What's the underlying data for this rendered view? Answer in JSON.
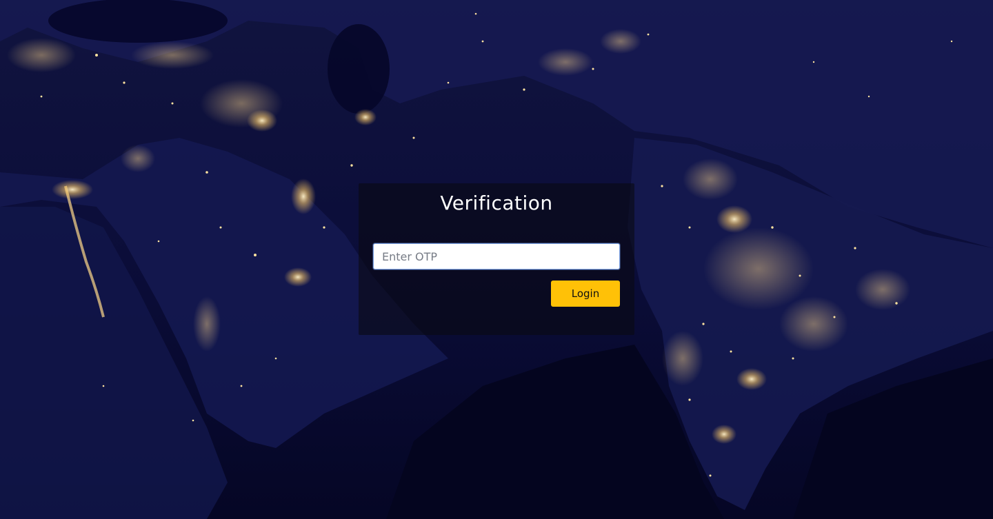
{
  "page": {
    "title": "Verification"
  },
  "form": {
    "otp_placeholder": "Enter OTP",
    "otp_value": "",
    "login_label": "Login"
  },
  "colors": {
    "button": "#ffc107",
    "panel": "rgba(10,10,20,0.62)",
    "background": "#0a0b33",
    "city_lights": "#ffd88a"
  }
}
